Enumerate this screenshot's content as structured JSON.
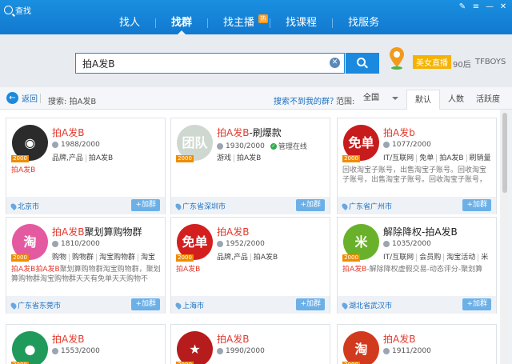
{
  "window": {
    "title": "查找"
  },
  "nav": {
    "items": [
      {
        "label": "找人"
      },
      {
        "label": "找群",
        "active": true
      },
      {
        "label": "找主播",
        "badge": "热"
      },
      {
        "label": "找课程"
      },
      {
        "label": "找服务"
      }
    ]
  },
  "search": {
    "value": "拍A发B",
    "placeholder": ""
  },
  "search_hints": {
    "live_tag": "美女直播",
    "hint1": "90后",
    "hint2": "TFBOYS"
  },
  "filter": {
    "back_label": "返回",
    "search_label": "搜索: 拍A发B",
    "not_found": "搜索不到我的群？",
    "range_label": "范围:",
    "range_value": "全国",
    "sort_tabs": [
      "默认",
      "人数",
      "活跃度"
    ]
  },
  "colors": {
    "accent": "#1b89dd",
    "highlight": "#e23a2e",
    "level": "#f08c00"
  },
  "cards": [
    {
      "avatar_icon": "akatsuki-cloud-icon",
      "avatar_color": "#2b2b2b",
      "avatar_glyph": "◉",
      "level": "2000",
      "name_hl": "拍A发B",
      "name_rest": "",
      "members": "1988/2000",
      "manager": "",
      "tags": [
        "品牌,产品",
        "拍A发B"
      ],
      "desc_hl": "拍A发B",
      "desc_rest": "",
      "location": "北京市",
      "join": "+加群"
    },
    {
      "avatar_icon": "team-logo-icon",
      "avatar_color": "#cfd8d0",
      "avatar_glyph": "团队",
      "level": "2000",
      "name_hl": "拍A发B",
      "name_rest": "-刷爆款",
      "members": "1930/2000",
      "manager": "管理在线",
      "tags": [
        "游戏",
        "拍A发B"
      ],
      "desc_hl": "",
      "desc_rest": "",
      "location": "广东省深圳市",
      "join": "+加群"
    },
    {
      "avatar_icon": "mianfei-badge-icon",
      "avatar_color": "#c81c1c",
      "avatar_glyph": "免单",
      "level": "2000",
      "name_hl": "拍A发b",
      "name_rest": "",
      "members": "1077/2000",
      "manager": "",
      "tags": [
        "IT/互联网",
        "免单",
        "拍A发B",
        "刷销量"
      ],
      "desc_hl": "",
      "desc_rest": "回收淘宝子账号，出售淘宝子账号。回收淘宝子账号，出售淘宝子账号。回收淘宝子账号，出售淘宝子...",
      "location": "广东省广州市",
      "join": "+加群"
    },
    {
      "avatar_icon": "taobao-badge-icon",
      "avatar_color": "#e45aa0",
      "avatar_glyph": "淘",
      "level": "2000",
      "name_hl": "拍A发B",
      "name_rest": "聚划算购物群",
      "members": "1810/2000",
      "manager": "",
      "tags": [
        "购物",
        "购物群",
        "淘宝购物群",
        "淘宝"
      ],
      "desc_hl": "拍A发B拍A发B",
      "desc_rest": "聚划算购物群淘宝购物群，聚划算购物群淘宝购物群天天有免单天天购物不花...",
      "location": "广东省东莞市",
      "join": "+加群"
    },
    {
      "avatar_icon": "mianfei-badge-icon",
      "avatar_color": "#d41f1f",
      "avatar_glyph": "免单",
      "level": "2000",
      "name_hl": "拍A发B",
      "name_rest": "",
      "members": "1952/2000",
      "manager": "",
      "tags": [
        "品牌,产品",
        "拍A发B"
      ],
      "desc_hl": "拍A发B",
      "desc_rest": "",
      "location": "上海市",
      "join": "+加群"
    },
    {
      "avatar_icon": "mipi-logo-icon",
      "avatar_color": "#6ab12b",
      "avatar_glyph": "米",
      "level": "2000",
      "name_hl": "",
      "name_rest": "解除降权-拍A发B",
      "members": "1035/2000",
      "manager": "",
      "tags": [
        "IT/互联网",
        "会员购",
        "淘宝活动",
        "米"
      ],
      "desc_hl": "拍A发B",
      "desc_rest": "-解除降权虚假交易-动态评分-聚划算",
      "location": "湖北省武汉市",
      "join": "+加群"
    },
    {
      "avatar_icon": "chat-bubble-icon",
      "avatar_color": "#1f9a5a",
      "avatar_glyph": "●",
      "level": "2000",
      "name_hl": "拍A发B",
      "name_rest": "",
      "members": "1553/2000",
      "manager": "",
      "tags": [],
      "desc_hl": "",
      "desc_rest": "",
      "location": "",
      "join": ""
    },
    {
      "avatar_icon": "emblem-badge-icon",
      "avatar_color": "#b71c1c",
      "avatar_glyph": "★",
      "level": "2000",
      "name_hl": "拍A发B",
      "name_rest": "",
      "members": "1990/2000",
      "manager": "",
      "tags": [],
      "desc_hl": "",
      "desc_rest": "",
      "location": "",
      "join": ""
    },
    {
      "avatar_icon": "taobao-round-icon",
      "avatar_color": "#d23a1e",
      "avatar_glyph": "淘",
      "level": "2000",
      "name_hl": "拍A发B",
      "name_rest": "",
      "members": "1911/2000",
      "manager": "",
      "tags": [],
      "desc_hl": "",
      "desc_rest": "",
      "location": "",
      "join": ""
    }
  ]
}
